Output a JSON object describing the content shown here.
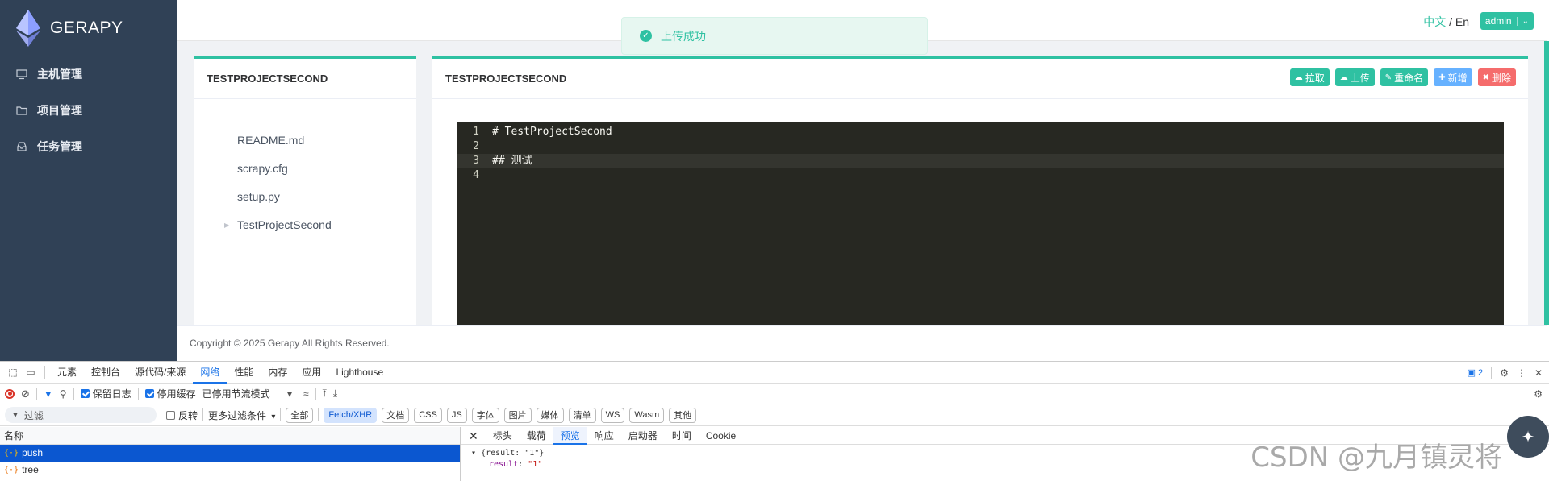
{
  "app": {
    "name": "GERAPY"
  },
  "sidebar": {
    "items": [
      {
        "label": "主机管理",
        "icon": "monitor-icon"
      },
      {
        "label": "项目管理",
        "icon": "folder-icon"
      },
      {
        "label": "任务管理",
        "icon": "inbox-icon"
      }
    ]
  },
  "header": {
    "lang_zh": "中文",
    "lang_sep": "/",
    "lang_en": "En",
    "user": "admin"
  },
  "toast": {
    "message": "上传成功"
  },
  "file_panel": {
    "title": "TESTPROJECTSECOND",
    "files": [
      "README.md",
      "scrapy.cfg",
      "setup.py",
      "TestProjectSecond"
    ]
  },
  "editor_panel": {
    "title": "TESTPROJECTSECOND",
    "actions": {
      "pull": "拉取",
      "upload": "上传",
      "rename": "重命名",
      "add": "新增",
      "delete": "删除"
    },
    "lines": [
      {
        "num": "1",
        "text": "# TestProjectSecond"
      },
      {
        "num": "2",
        "text": ""
      },
      {
        "num": "3",
        "text": "## 测试"
      },
      {
        "num": "4",
        "text": ""
      }
    ]
  },
  "footer": {
    "copyright": "Copyright © 2025 Gerapy All Rights Reserved."
  },
  "devtools": {
    "tabs": [
      "元素",
      "控制台",
      "源代码/来源",
      "网络",
      "性能",
      "内存",
      "应用",
      "Lighthouse"
    ],
    "active_tab": "网络",
    "message_count": "2",
    "preserve_log": "保留日志",
    "disable_cache": "停用缓存",
    "throttle": "已停用节流模式",
    "filter_placeholder": "过滤",
    "invert": "反转",
    "more_filters": "更多过滤条件",
    "type_filters": [
      "全部",
      "Fetch/XHR",
      "文档",
      "CSS",
      "JS",
      "字体",
      "图片",
      "媒体",
      "清单",
      "WS",
      "Wasm",
      "其他"
    ],
    "active_filter": "Fetch/XHR",
    "name_header": "名称",
    "requests": [
      "push",
      "tree"
    ],
    "detail_tabs": [
      "标头",
      "载荷",
      "预览",
      "响应",
      "启动器",
      "时间",
      "Cookie"
    ],
    "active_detail_tab": "预览",
    "preview_line1": "{result: \"1\"}",
    "preview_key": "result",
    "preview_value": "\"1\""
  },
  "watermark": {
    "text": "CSDN @九月镇灵将"
  }
}
